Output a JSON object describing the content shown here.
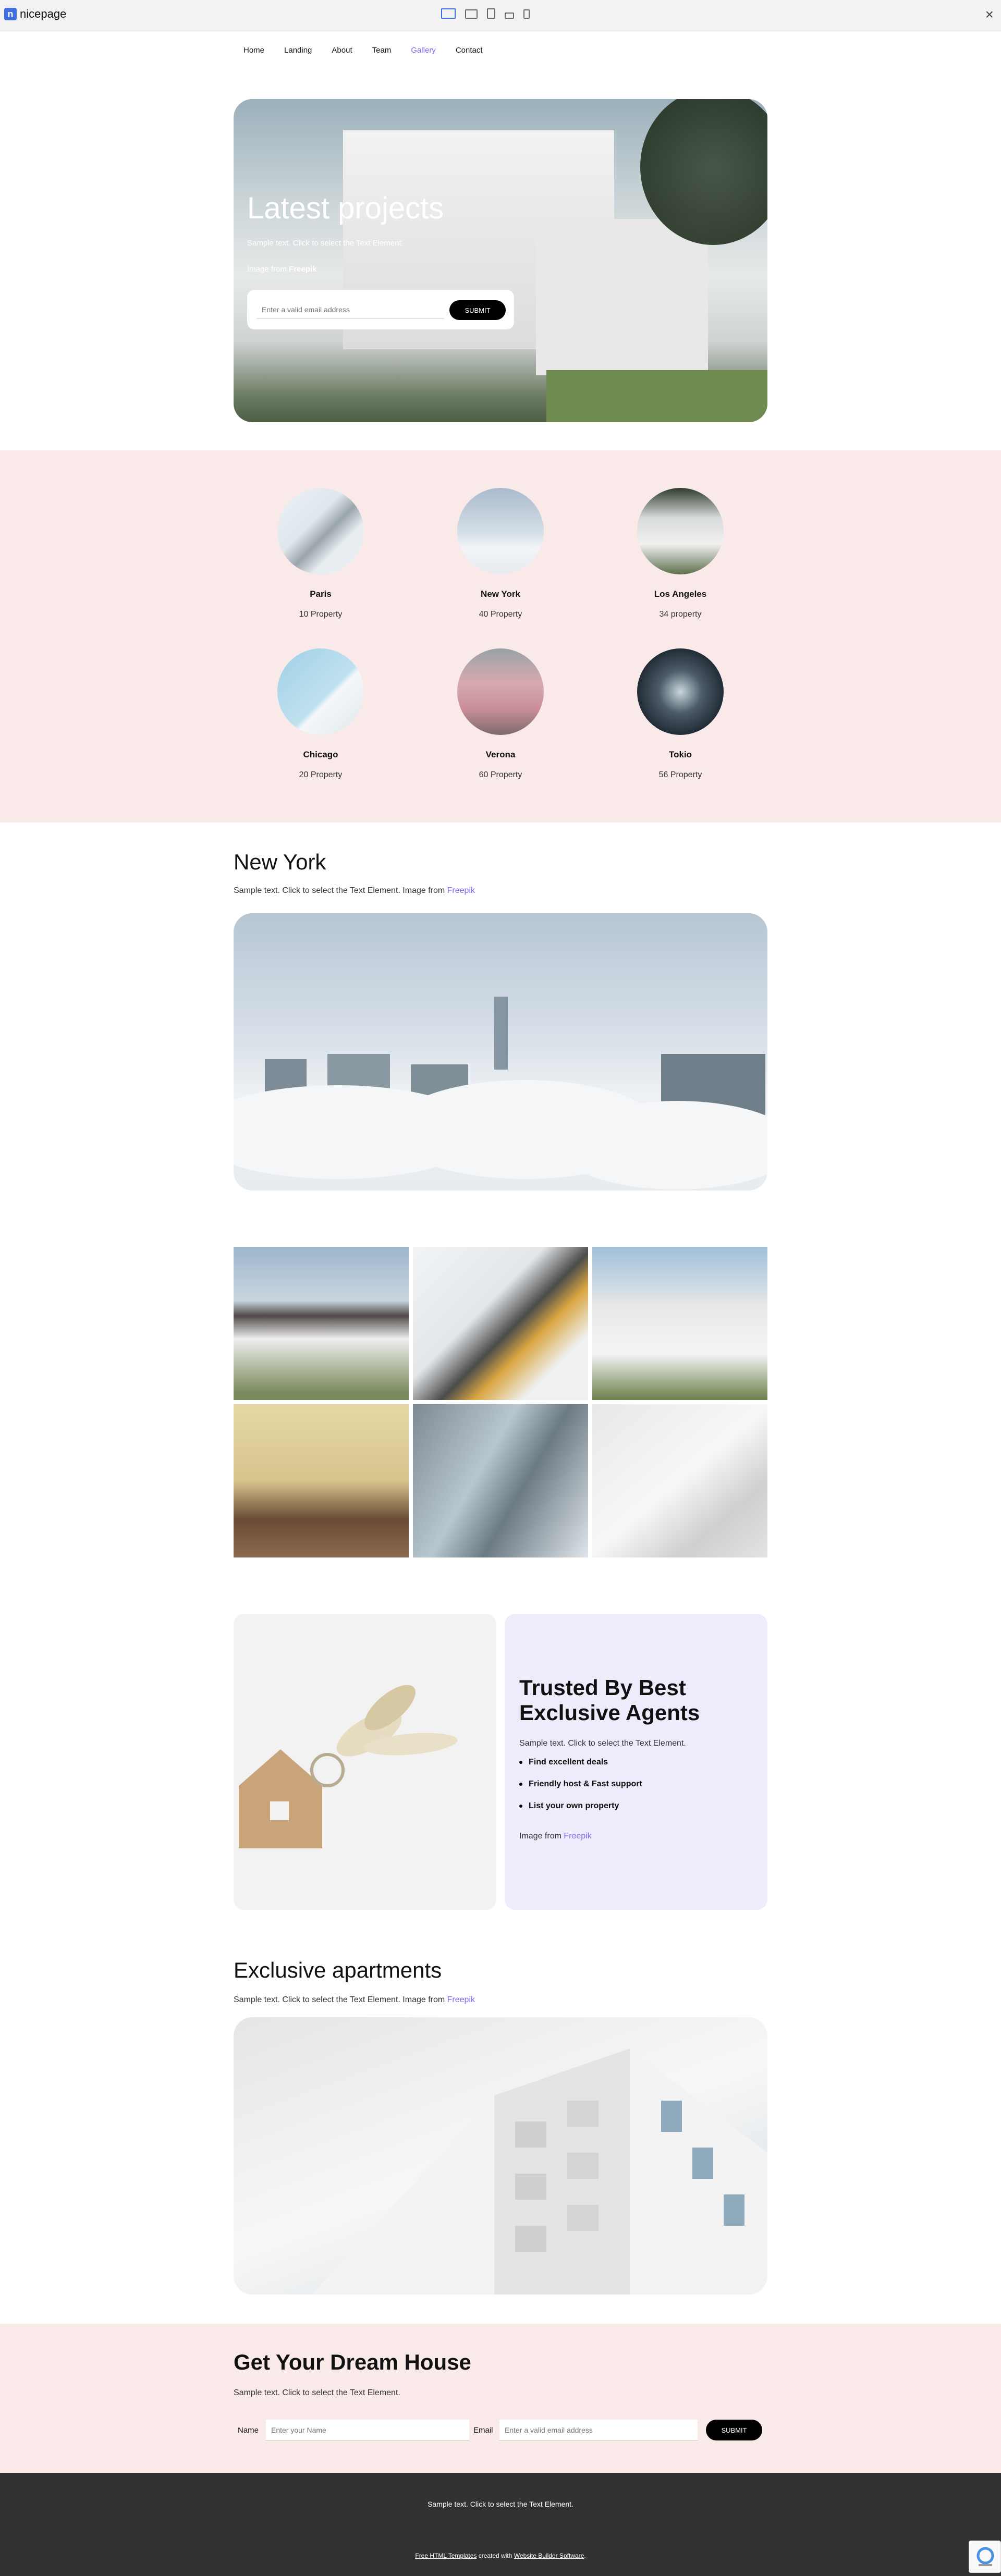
{
  "app": {
    "brand": "nicepage",
    "brand_logo": "n",
    "devices": [
      "desktop-icon",
      "laptop-icon",
      "tablet-icon",
      "phone-landscape-icon",
      "phone-icon"
    ],
    "close_icon": "×"
  },
  "nav": {
    "items": [
      "Home",
      "Landing",
      "About",
      "Team",
      "Gallery",
      "Contact"
    ],
    "active": "Gallery"
  },
  "hero": {
    "title": "Latest projects",
    "text": "Sample text. Click to select the Text Element.",
    "image_from_prefix": "Image from ",
    "image_from_link": "Freepik",
    "email_placeholder": "Enter a valid email address",
    "submit_label": "SUBMIT"
  },
  "cities": [
    {
      "name": "Paris",
      "count": "10 Property"
    },
    {
      "name": "New York",
      "count": "40 Property"
    },
    {
      "name": "Los Angeles",
      "count": "34 property"
    },
    {
      "name": "Chicago",
      "count": "20 Property"
    },
    {
      "name": "Verona",
      "count": "60 Property"
    },
    {
      "name": "Tokio",
      "count": "56 Property"
    }
  ],
  "new_york": {
    "title": "New York",
    "text_prefix": "Sample text. Click to select the Text Element. Image from ",
    "link": "Freepik"
  },
  "agents": {
    "title": "Trusted By Best Exclusive Agents",
    "text": "Sample text. Click to select the Text Element.",
    "list": [
      "Find excellent deals",
      "Friendly host & Fast support",
      "List your own property"
    ],
    "image_from_prefix": "Image from ",
    "image_from_link": "Freepik"
  },
  "exclusive": {
    "title": "Exclusive apartments",
    "text_prefix": "Sample text. Click to select the Text Element. Image from ",
    "link": "Freepik"
  },
  "dream": {
    "title": "Get Your Dream House",
    "text": "Sample text. Click to select the Text Element.",
    "name_label": "Name",
    "name_placeholder": "Enter your Name",
    "email_label": "Email",
    "email_placeholder": "Enter a valid email address",
    "submit_label": "SUBMIT"
  },
  "footer": {
    "text": "Sample text. Click to select the Text Element.",
    "credit_link1": "Free HTML Templates",
    "credit_mid": " created with ",
    "credit_link2": "Website Builder Software",
    "credit_end": "."
  },
  "colors": {
    "accent": "#7b6cf0",
    "pink_section": "#f9e9e9",
    "lavender_card": "#eeecfb",
    "footer_bg": "#323232"
  }
}
